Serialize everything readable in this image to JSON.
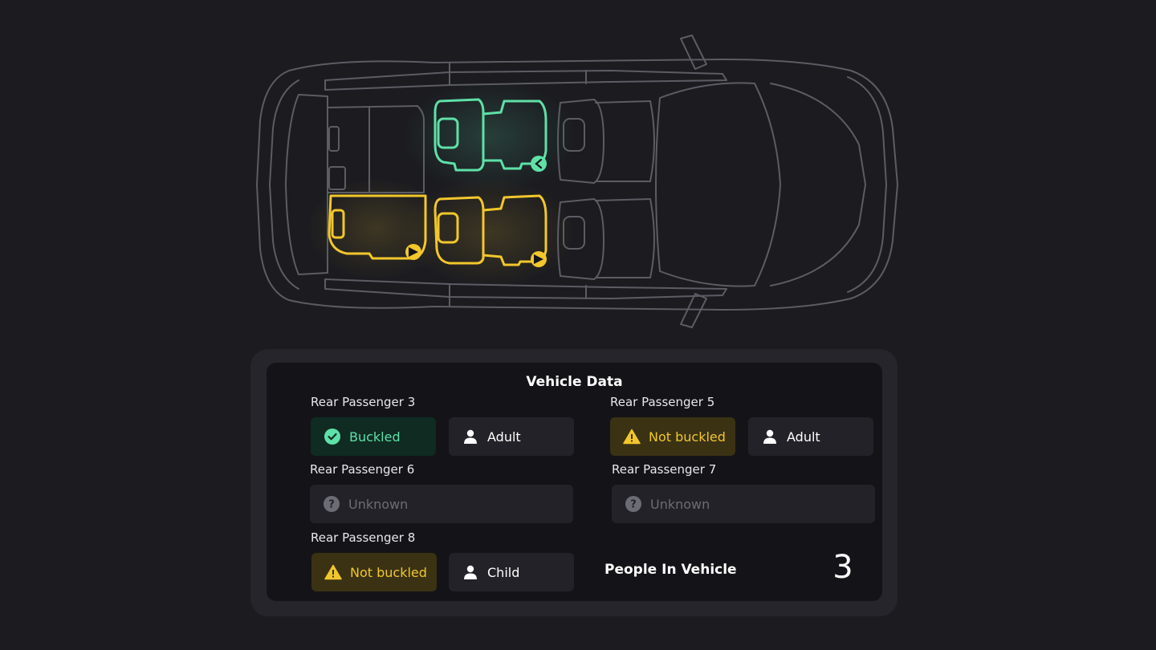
{
  "panel": {
    "title": "Vehicle Data",
    "people_label": "People In Vehicle",
    "people_count": "3"
  },
  "passengers": [
    {
      "label": "Rear Passenger 3",
      "status": "Buckled",
      "status_type": "buckled",
      "occupant": "Adult"
    },
    {
      "label": "Rear Passenger 5",
      "status": "Not buckled",
      "status_type": "warning",
      "occupant": "Adult"
    },
    {
      "label": "Rear Passenger 6",
      "status": "Unknown",
      "status_type": "unknown"
    },
    {
      "label": "Rear Passenger 7",
      "status": "Unknown",
      "status_type": "unknown"
    },
    {
      "label": "Rear Passenger 8",
      "status": "Not buckled",
      "status_type": "warning",
      "occupant": "Child"
    }
  ],
  "colors": {
    "buckled": "#5fe0a8",
    "warning": "#f2c72c",
    "outline": "#5c5c64",
    "background": "#1b1b20"
  },
  "icons": {
    "buckled": "check-circle-icon",
    "warning": "warning-triangle-icon",
    "unknown": "question-circle-icon",
    "occupant": "person-icon"
  }
}
